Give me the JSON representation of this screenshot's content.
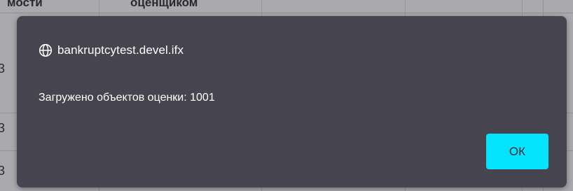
{
  "background_table": {
    "header_cells": [
      "мости",
      "оценщиком"
    ],
    "row_markers": [
      "3",
      "3",
      "3"
    ]
  },
  "dialog": {
    "origin_icon": "globe-icon",
    "origin": "bankruptcytest.devel.ifx",
    "message": "Загружено объектов оценки: 1001",
    "ok_label": "ОК"
  },
  "colors": {
    "dialog_bg": "#45444f",
    "ok_button_bg": "#05e4ff",
    "overlay_bg": "#a9a9ae"
  }
}
